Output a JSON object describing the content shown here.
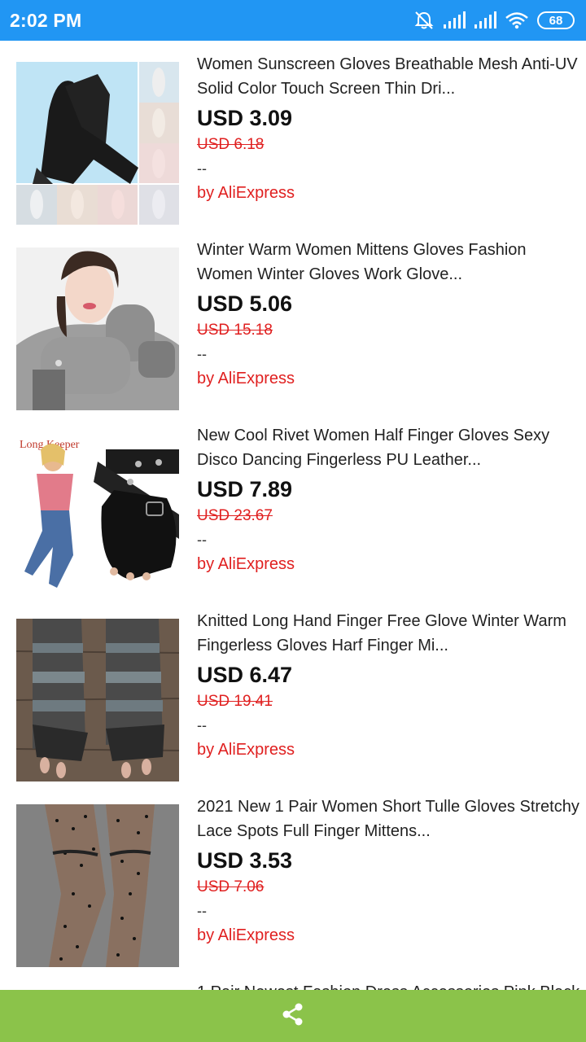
{
  "status_bar": {
    "time": "2:02 PM",
    "battery": "68",
    "icons": [
      "alarm-off-icon",
      "signal-icon",
      "signal-icon",
      "wifi-icon",
      "battery-icon"
    ]
  },
  "products": [
    {
      "title": "Women Sunscreen Gloves Breathable Mesh Anti-UV Solid Color Touch Screen Thin Dri...",
      "price": "USD 3.09",
      "old_price": "USD 6.18",
      "rating": "--",
      "seller": "by AliExpress"
    },
    {
      "title": "Winter Warm Women Mittens Gloves Fashion Women Winter Gloves Work Glove...",
      "price": "USD 5.06",
      "old_price": "USD 15.18",
      "rating": "--",
      "seller": "by AliExpress"
    },
    {
      "title": "New Cool Rivet Women Half Finger Gloves Sexy Disco Dancing Fingerless PU Leather...",
      "price": "USD 7.89",
      "old_price": "USD 23.67",
      "rating": "--",
      "seller": "by AliExpress"
    },
    {
      "title": "Knitted Long Hand Finger Free Glove Winter Warm Fingerless Gloves Harf Finger Mi...",
      "price": "USD 6.47",
      "old_price": "USD 19.41",
      "rating": "--",
      "seller": "by AliExpress"
    },
    {
      "title": "2021 New 1 Pair Women Short Tulle Gloves Stretchy Lace Spots Full Finger Mittens...",
      "price": "USD 3.53",
      "old_price": "USD 7.06",
      "rating": "--",
      "seller": "by AliExpress"
    }
  ],
  "partial_item": {
    "title": "1 Pair Newest Fashion Dress Accessories Pink Black"
  },
  "thumb_text": {
    "brand": "Long Keeper"
  },
  "bottom_bar": {
    "icon": "share-icon"
  },
  "colors": {
    "status_bar": "#2196f3",
    "bottom_bar": "#8bc34a",
    "accent_red": "#e02020"
  }
}
